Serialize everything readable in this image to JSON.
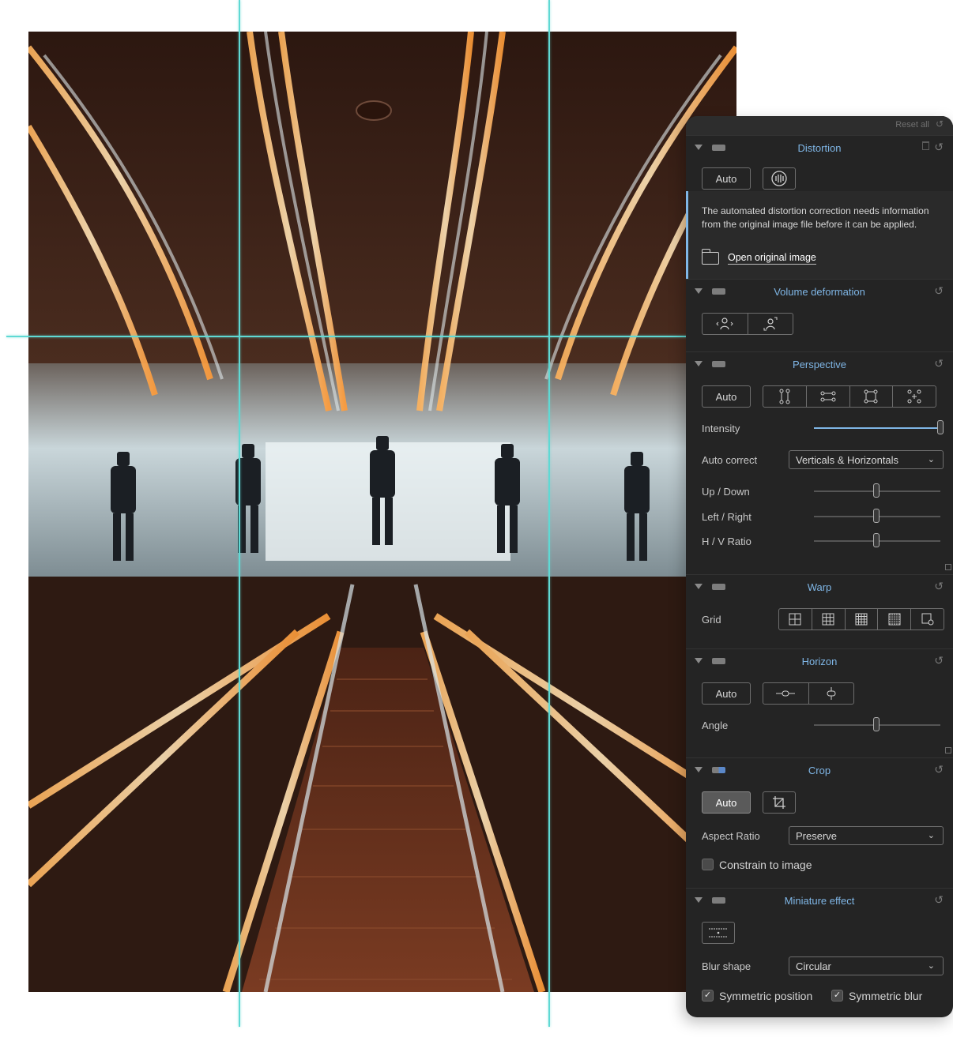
{
  "panel": {
    "reset_all": "Reset all",
    "sections": {
      "distortion": {
        "title": "Distortion",
        "auto_label": "Auto",
        "info_text": "The automated distortion correction needs information from the original image file before it can be applied.",
        "open_link": "Open original image"
      },
      "volume": {
        "title": "Volume deformation"
      },
      "perspective": {
        "title": "Perspective",
        "auto_label": "Auto",
        "intensity_label": "Intensity",
        "intensity_value": 1.0,
        "auto_correct_label": "Auto correct",
        "auto_correct_value": "Verticals & Horizontals",
        "up_down_label": "Up / Down",
        "left_right_label": "Left / Right",
        "hv_ratio_label": "H / V Ratio"
      },
      "warp": {
        "title": "Warp",
        "grid_label": "Grid"
      },
      "horizon": {
        "title": "Horizon",
        "auto_label": "Auto",
        "angle_label": "Angle"
      },
      "crop": {
        "title": "Crop",
        "auto_label": "Auto",
        "aspect_label": "Aspect Ratio",
        "aspect_value": "Preserve",
        "constrain_label": "Constrain to image",
        "constrain_checked": false
      },
      "miniature": {
        "title": "Miniature effect",
        "blur_shape_label": "Blur shape",
        "blur_shape_value": "Circular",
        "sym_position_label": "Symmetric position",
        "sym_blur_label": "Symmetric blur",
        "sym_position_checked": true,
        "sym_blur_checked": true
      }
    }
  },
  "colors": {
    "guide": "#5fd9d4",
    "accent": "#7fb6e6",
    "panel_bg": "#242424"
  }
}
